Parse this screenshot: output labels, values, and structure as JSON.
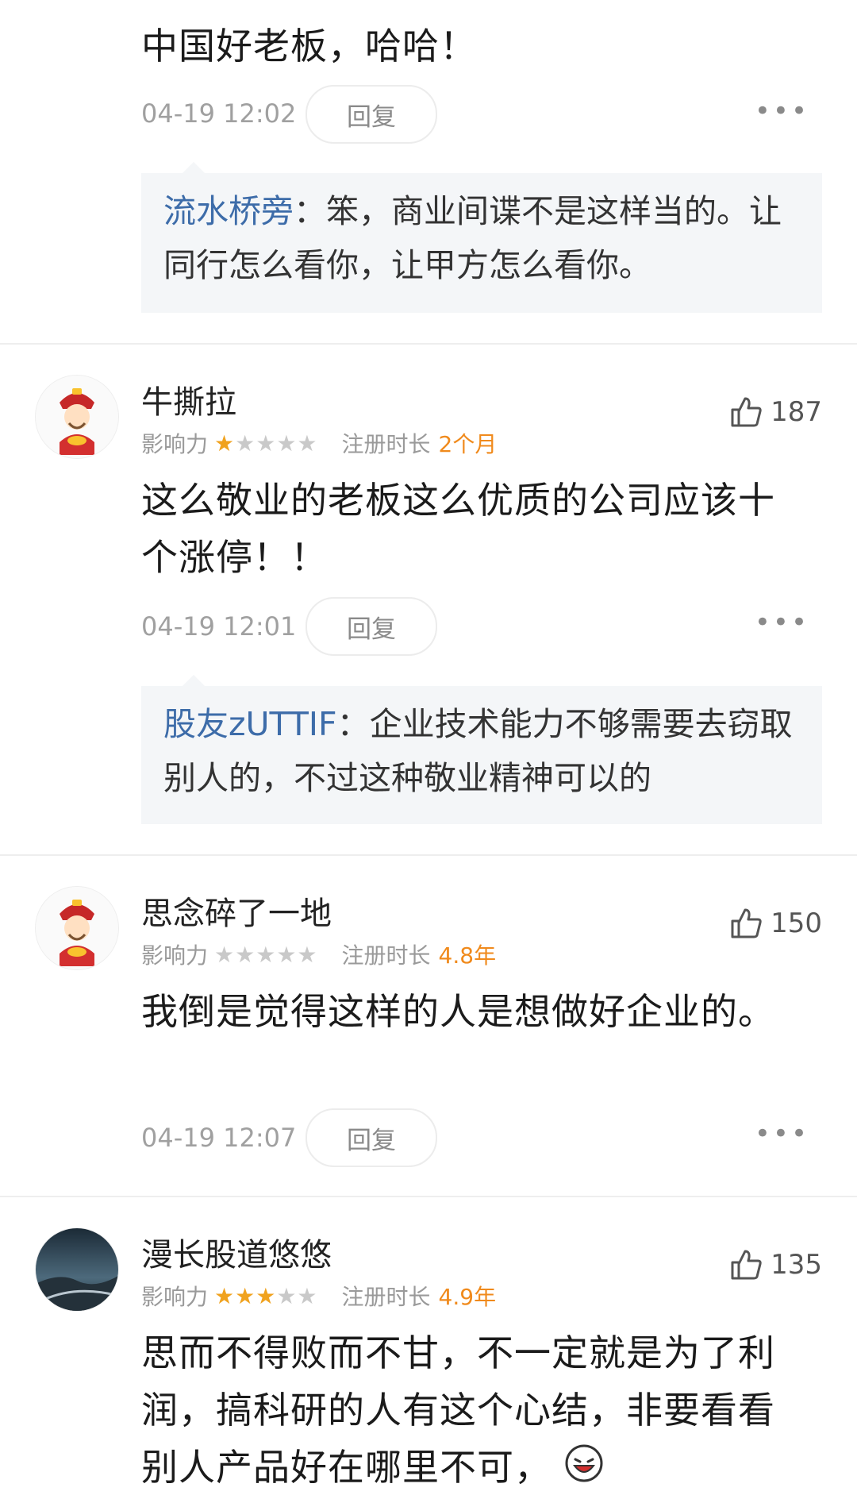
{
  "comments": [
    {
      "id": "c0",
      "text": "中国好老板，哈哈！",
      "time": "04-19 12:02",
      "reply_label": "回复",
      "more_label": "•••",
      "reply": {
        "user": "流水桥旁",
        "sep": "：",
        "text": "笨，商业间谍不是这样当的。让同行怎么看你，让甲方怎么看你。"
      }
    },
    {
      "id": "c1",
      "username": "牛撕拉",
      "influence_label": "影响力",
      "rating": 1,
      "stars_total": 5,
      "reg_label": "注册时长",
      "reg_value": "2个月",
      "likes": "187",
      "avatar": "caishen-avatar",
      "text": "这么敬业的老板这么优质的公司应该十个涨停！！",
      "time": "04-19 12:01",
      "reply_label": "回复",
      "more_label": "•••",
      "reply": {
        "user": "股友zUTTIF",
        "sep": "：",
        "text": "企业技术能力不够需要去窃取别人的，不过这种敬业精神可以的"
      }
    },
    {
      "id": "c2",
      "username": "思念碎了一地",
      "influence_label": "影响力",
      "rating": 0,
      "stars_total": 5,
      "reg_label": "注册时长",
      "reg_value": "4.8年",
      "likes": "150",
      "avatar": "caishen-avatar",
      "text": "我倒是觉得这样的人是想做好企业的。",
      "time": "04-19 12:07",
      "reply_label": "回复",
      "more_label": "•••"
    },
    {
      "id": "c3",
      "username": "漫长股道悠悠",
      "influence_label": "影响力",
      "rating": 3,
      "stars_total": 5,
      "reg_label": "注册时长",
      "reg_value": "4.9年",
      "likes": "135",
      "avatar": "landscape-avatar",
      "text": "思而不得败而不甘，不一定就是为了利润，搞科研的人有这个心结，非要看看别人产品好在哪里不可，",
      "trailing_emoji": "laughing-emoji"
    }
  ],
  "colors": {
    "star_on": "#f0a21e",
    "star_off": "#c9c9c9",
    "reg_value": "#f08a1c",
    "reply_user": "#3d6ca9",
    "reply_bg": "#f4f6f8"
  }
}
